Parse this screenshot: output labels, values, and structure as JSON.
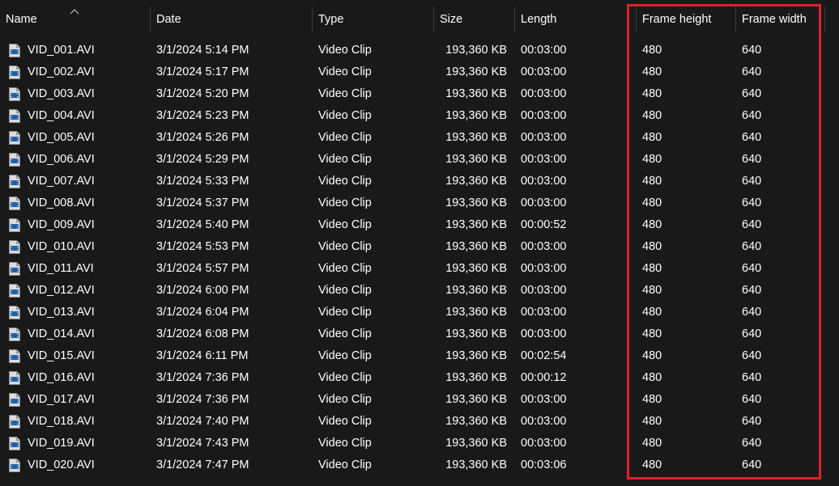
{
  "columns": {
    "name": "Name",
    "date": "Date",
    "type": "Type",
    "size": "Size",
    "length": "Length",
    "frame_height": "Frame height",
    "frame_width": "Frame width"
  },
  "sort": {
    "column": "Name",
    "direction": "ascending",
    "icon": "chevron-up-icon"
  },
  "highlight_color": "#e0202a",
  "file_icon": "video-file-icon",
  "files": [
    {
      "name": "VID_001.AVI",
      "date": "3/1/2024 5:14 PM",
      "type": "Video Clip",
      "size": "193,360 KB",
      "length": "00:03:00",
      "frame_height": "480",
      "frame_width": "640"
    },
    {
      "name": "VID_002.AVI",
      "date": "3/1/2024 5:17 PM",
      "type": "Video Clip",
      "size": "193,360 KB",
      "length": "00:03:00",
      "frame_height": "480",
      "frame_width": "640"
    },
    {
      "name": "VID_003.AVI",
      "date": "3/1/2024 5:20 PM",
      "type": "Video Clip",
      "size": "193,360 KB",
      "length": "00:03:00",
      "frame_height": "480",
      "frame_width": "640"
    },
    {
      "name": "VID_004.AVI",
      "date": "3/1/2024 5:23 PM",
      "type": "Video Clip",
      "size": "193,360 KB",
      "length": "00:03:00",
      "frame_height": "480",
      "frame_width": "640"
    },
    {
      "name": "VID_005.AVI",
      "date": "3/1/2024 5:26 PM",
      "type": "Video Clip",
      "size": "193,360 KB",
      "length": "00:03:00",
      "frame_height": "480",
      "frame_width": "640"
    },
    {
      "name": "VID_006.AVI",
      "date": "3/1/2024 5:29 PM",
      "type": "Video Clip",
      "size": "193,360 KB",
      "length": "00:03:00",
      "frame_height": "480",
      "frame_width": "640"
    },
    {
      "name": "VID_007.AVI",
      "date": "3/1/2024 5:33 PM",
      "type": "Video Clip",
      "size": "193,360 KB",
      "length": "00:03:00",
      "frame_height": "480",
      "frame_width": "640"
    },
    {
      "name": "VID_008.AVI",
      "date": "3/1/2024 5:37 PM",
      "type": "Video Clip",
      "size": "193,360 KB",
      "length": "00:03:00",
      "frame_height": "480",
      "frame_width": "640"
    },
    {
      "name": "VID_009.AVI",
      "date": "3/1/2024 5:40 PM",
      "type": "Video Clip",
      "size": "193,360 KB",
      "length": "00:00:52",
      "frame_height": "480",
      "frame_width": "640"
    },
    {
      "name": "VID_010.AVI",
      "date": "3/1/2024 5:53 PM",
      "type": "Video Clip",
      "size": "193,360 KB",
      "length": "00:03:00",
      "frame_height": "480",
      "frame_width": "640"
    },
    {
      "name": "VID_011.AVI",
      "date": "3/1/2024 5:57 PM",
      "type": "Video Clip",
      "size": "193,360 KB",
      "length": "00:03:00",
      "frame_height": "480",
      "frame_width": "640"
    },
    {
      "name": "VID_012.AVI",
      "date": "3/1/2024 6:00 PM",
      "type": "Video Clip",
      "size": "193,360 KB",
      "length": "00:03:00",
      "frame_height": "480",
      "frame_width": "640"
    },
    {
      "name": "VID_013.AVI",
      "date": "3/1/2024 6:04 PM",
      "type": "Video Clip",
      "size": "193,360 KB",
      "length": "00:03:00",
      "frame_height": "480",
      "frame_width": "640"
    },
    {
      "name": "VID_014.AVI",
      "date": "3/1/2024 6:08 PM",
      "type": "Video Clip",
      "size": "193,360 KB",
      "length": "00:03:00",
      "frame_height": "480",
      "frame_width": "640"
    },
    {
      "name": "VID_015.AVI",
      "date": "3/1/2024 6:11 PM",
      "type": "Video Clip",
      "size": "193,360 KB",
      "length": "00:02:54",
      "frame_height": "480",
      "frame_width": "640"
    },
    {
      "name": "VID_016.AVI",
      "date": "3/1/2024 7:36 PM",
      "type": "Video Clip",
      "size": "193,360 KB",
      "length": "00:00:12",
      "frame_height": "480",
      "frame_width": "640"
    },
    {
      "name": "VID_017.AVI",
      "date": "3/1/2024 7:36 PM",
      "type": "Video Clip",
      "size": "193,360 KB",
      "length": "00:03:00",
      "frame_height": "480",
      "frame_width": "640"
    },
    {
      "name": "VID_018.AVI",
      "date": "3/1/2024 7:40 PM",
      "type": "Video Clip",
      "size": "193,360 KB",
      "length": "00:03:00",
      "frame_height": "480",
      "frame_width": "640"
    },
    {
      "name": "VID_019.AVI",
      "date": "3/1/2024 7:43 PM",
      "type": "Video Clip",
      "size": "193,360 KB",
      "length": "00:03:00",
      "frame_height": "480",
      "frame_width": "640"
    },
    {
      "name": "VID_020.AVI",
      "date": "3/1/2024 7:47 PM",
      "type": "Video Clip",
      "size": "193,360 KB",
      "length": "00:03:06",
      "frame_height": "480",
      "frame_width": "640"
    }
  ]
}
